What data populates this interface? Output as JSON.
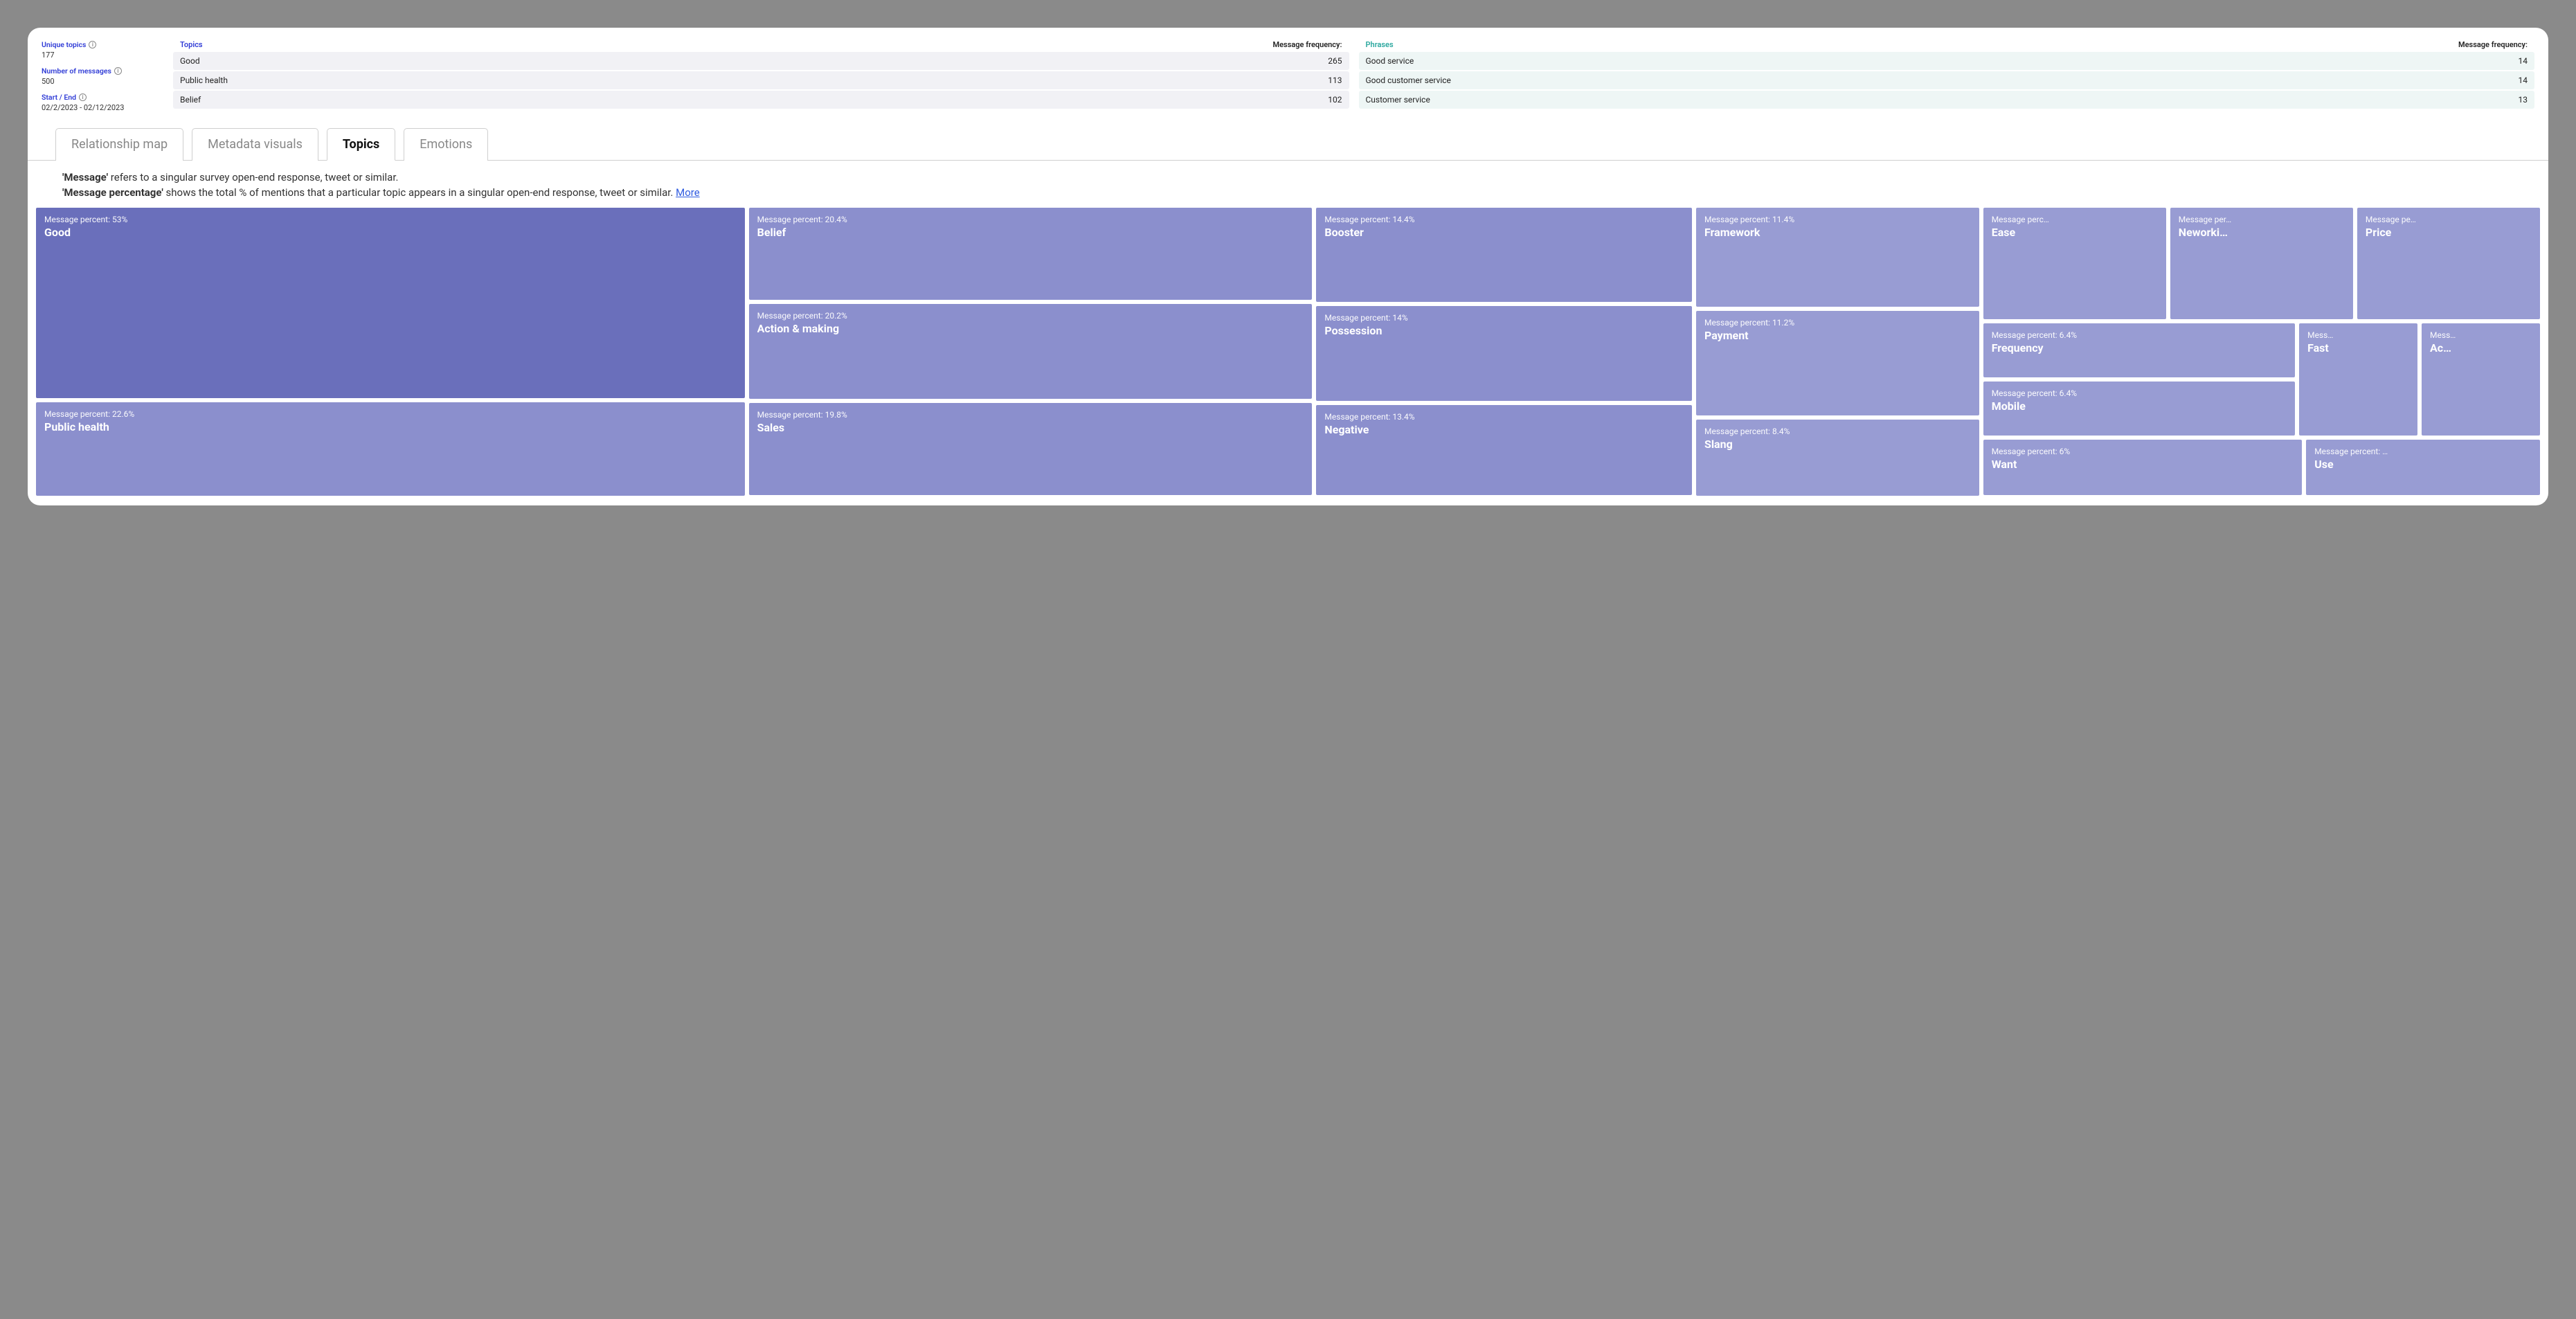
{
  "stats": {
    "unique_topics_label": "Unique topics",
    "unique_topics_value": "177",
    "num_messages_label": "Number of messages",
    "num_messages_value": "500",
    "start_end_label": "Start / End",
    "start_end_value": "02/2/2023 - 02/12/2023"
  },
  "topics_table": {
    "title": "Topics",
    "freq_label": "Message frequency:",
    "rows": [
      {
        "name": "Good",
        "freq": "265"
      },
      {
        "name": "Public health",
        "freq": "113"
      },
      {
        "name": "Belief",
        "freq": "102"
      }
    ]
  },
  "phrases_table": {
    "title": "Phrases",
    "freq_label": "Message frequency:",
    "rows": [
      {
        "name": "Good service",
        "freq": "14"
      },
      {
        "name": "Good customer service",
        "freq": "14"
      },
      {
        "name": "Customer service",
        "freq": "13"
      }
    ]
  },
  "tabs": {
    "relationship": "Relationship map",
    "metadata": "Metadata visuals",
    "topics": "Topics",
    "emotions": "Emotions"
  },
  "description": {
    "line1_bold": "'Message'",
    "line1_rest": " refers to a singular survey open-end response, tweet or similar.",
    "line2_bold": "'Message percentage'",
    "line2_rest": " shows the total % of mentions that a particular topic appears in a singular open-end response, tweet or similar. ",
    "more": "More"
  },
  "pct_prefix": "Message percent: ",
  "chart_data": {
    "type": "treemap",
    "value_label": "Message percent",
    "items": [
      {
        "name": "Good",
        "percent": 53.0
      },
      {
        "name": "Public health",
        "percent": 22.6
      },
      {
        "name": "Belief",
        "percent": 20.4
      },
      {
        "name": "Action & making",
        "percent": 20.2
      },
      {
        "name": "Sales",
        "percent": 19.8
      },
      {
        "name": "Booster",
        "percent": 14.4
      },
      {
        "name": "Possession",
        "percent": 14.0
      },
      {
        "name": "Negative",
        "percent": 13.4
      },
      {
        "name": "Framework",
        "percent": 11.4
      },
      {
        "name": "Payment",
        "percent": 11.2
      },
      {
        "name": "Slang",
        "percent": 8.4
      },
      {
        "name": "Ease",
        "percent": null
      },
      {
        "name": "Neworking",
        "percent": null
      },
      {
        "name": "Price",
        "percent": null
      },
      {
        "name": "Frequency",
        "percent": 6.4
      },
      {
        "name": "Fast",
        "percent": null
      },
      {
        "name": "Account",
        "percent": null
      },
      {
        "name": "Mobile",
        "percent": 6.4
      },
      {
        "name": "Want",
        "percent": 6.0
      },
      {
        "name": "Use",
        "percent": null
      }
    ]
  },
  "tm": {
    "good": {
      "pct": "Message percent: 53%",
      "name": "Good"
    },
    "pubhealth": {
      "pct": "Message percent: 22.6%",
      "name": "Public health"
    },
    "belief": {
      "pct": "Message percent: 20.4%",
      "name": "Belief"
    },
    "action": {
      "pct": "Message percent: 20.2%",
      "name": "Action & making"
    },
    "sales": {
      "pct": "Message percent: 19.8%",
      "name": "Sales"
    },
    "booster": {
      "pct": "Message percent: 14.4%",
      "name": "Booster"
    },
    "possession": {
      "pct": "Message percent: 14%",
      "name": "Possession"
    },
    "negative": {
      "pct": "Message percent: 13.4%",
      "name": "Negative"
    },
    "framework": {
      "pct": "Message percent: 11.4%",
      "name": "Framework"
    },
    "payment": {
      "pct": "Message percent: 11.2%",
      "name": "Payment"
    },
    "slang": {
      "pct": "Message percent: 8.4%",
      "name": "Slang"
    },
    "ease": {
      "pct": "Message perc…",
      "name": "Ease"
    },
    "neworking": {
      "pct": "Message per…",
      "name": "Neworki…"
    },
    "price": {
      "pct": "Message pe…",
      "name": "Price"
    },
    "frequency": {
      "pct": "Message percent: 6.4%",
      "name": "Frequency"
    },
    "fast": {
      "pct": "Mess…",
      "name": "Fast"
    },
    "account": {
      "pct": "Mess…",
      "name": "Ac…"
    },
    "mobile": {
      "pct": "Message percent: 6.4%",
      "name": "Mobile"
    },
    "want": {
      "pct": "Message percent: 6%",
      "name": "Want"
    },
    "use": {
      "pct": "Message percent: …",
      "name": "Use"
    }
  }
}
